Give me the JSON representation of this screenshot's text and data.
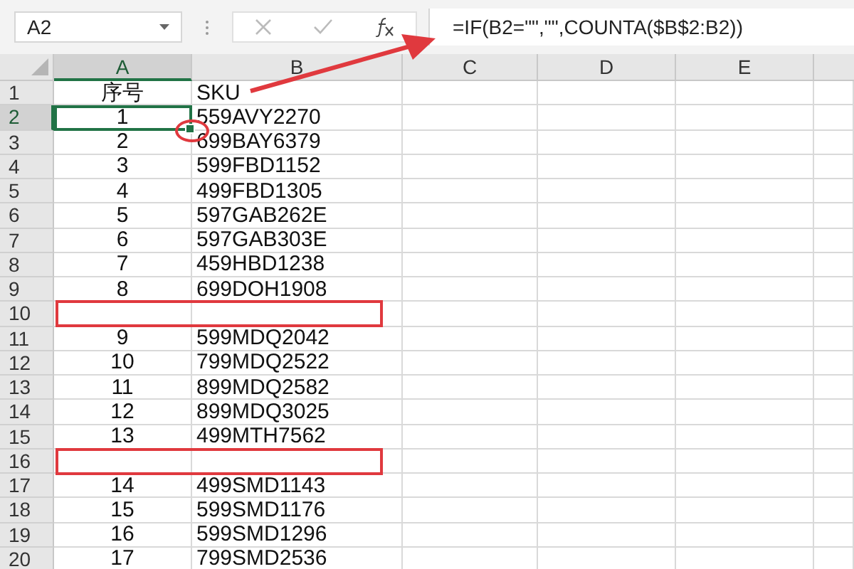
{
  "formula_bar": {
    "name_box": "A2",
    "formula": "=IF(B2=\"\",\"\",COUNTA($B$2:B2))"
  },
  "columns": [
    {
      "label": "A",
      "selected": true
    },
    {
      "label": "B",
      "selected": false
    },
    {
      "label": "C",
      "selected": false
    },
    {
      "label": "D",
      "selected": false
    },
    {
      "label": "E",
      "selected": false
    }
  ],
  "rows": [
    {
      "number": "1",
      "selected": false,
      "highlighted": false,
      "cells": [
        "序号",
        "SKU"
      ]
    },
    {
      "number": "2",
      "selected": true,
      "highlighted": false,
      "cells": [
        "1",
        "559AVY2270"
      ]
    },
    {
      "number": "3",
      "selected": false,
      "highlighted": false,
      "cells": [
        "2",
        "699BAY6379"
      ]
    },
    {
      "number": "4",
      "selected": false,
      "highlighted": false,
      "cells": [
        "3",
        "599FBD1152"
      ]
    },
    {
      "number": "5",
      "selected": false,
      "highlighted": false,
      "cells": [
        "4",
        "499FBD1305"
      ]
    },
    {
      "number": "6",
      "selected": false,
      "highlighted": false,
      "cells": [
        "5",
        "597GAB262E"
      ]
    },
    {
      "number": "7",
      "selected": false,
      "highlighted": false,
      "cells": [
        "6",
        "597GAB303E"
      ]
    },
    {
      "number": "8",
      "selected": false,
      "highlighted": false,
      "cells": [
        "7",
        "459HBD1238"
      ]
    },
    {
      "number": "9",
      "selected": false,
      "highlighted": false,
      "cells": [
        "8",
        "699DOH1908"
      ]
    },
    {
      "number": "10",
      "selected": false,
      "highlighted": true
    },
    {
      "number": "11",
      "selected": false,
      "highlighted": false,
      "cells": [
        "9",
        "599MDQ2042"
      ]
    },
    {
      "number": "12",
      "selected": false,
      "highlighted": false,
      "cells": [
        "10",
        "799MDQ2522"
      ]
    },
    {
      "number": "13",
      "selected": false,
      "highlighted": false,
      "cells": [
        "11",
        "899MDQ2582"
      ]
    },
    {
      "number": "14",
      "selected": false,
      "highlighted": false,
      "cells": [
        "12",
        "899MDQ3025"
      ]
    },
    {
      "number": "15",
      "selected": false,
      "highlighted": false,
      "cells": [
        "13",
        "499MTH7562"
      ]
    },
    {
      "number": "16",
      "selected": false,
      "highlighted": true
    },
    {
      "number": "17",
      "selected": false,
      "highlighted": false,
      "cells": [
        "14",
        "499SMD1143"
      ]
    },
    {
      "number": "18",
      "selected": false,
      "highlighted": false,
      "cells": [
        "15",
        "599SMD1176"
      ]
    },
    {
      "number": "19",
      "selected": false,
      "highlighted": false,
      "cells": [
        "16",
        "599SMD1296"
      ]
    },
    {
      "number": "20",
      "selected": false,
      "highlighted": false,
      "cells": [
        "17",
        "799SMD2536"
      ]
    }
  ]
}
